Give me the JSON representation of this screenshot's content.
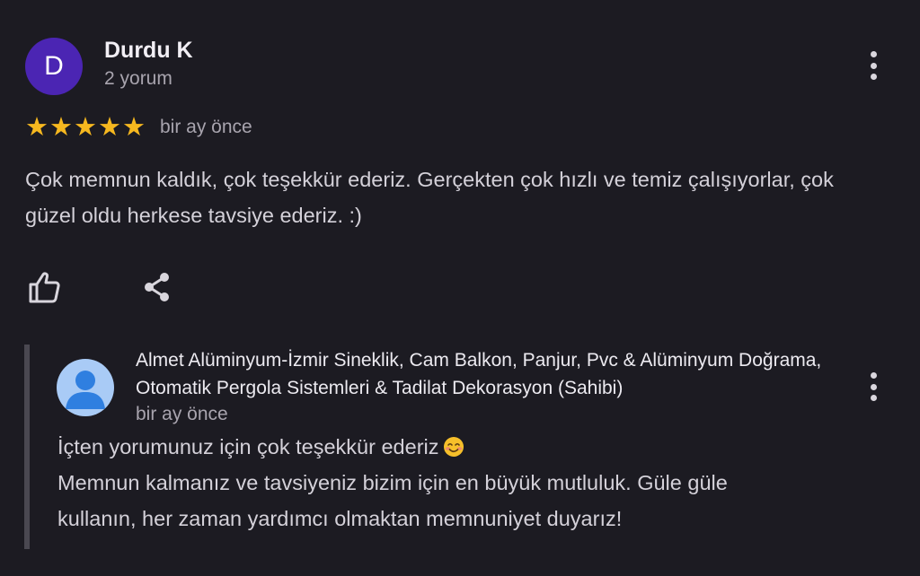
{
  "review": {
    "avatar_letter": "D",
    "author": "Durdu K",
    "review_count": "2 yorum",
    "rating": 5,
    "time": "bir ay önce",
    "text": "Çok memnun kaldık, çok teşekkür ederiz. Gerçekten çok hızlı ve temiz çalışıyorlar, çok güzel oldu herkese tavsiye ederiz. :)"
  },
  "icons": {
    "more": "more-vertical-icon",
    "like": "thumbs-up-icon",
    "share": "share-icon",
    "owner_avatar": "person-icon",
    "emoji": "smiling-face-emoji"
  },
  "owner_reply": {
    "name": "Almet Alüminyum-İzmir Sineklik, Cam Balkon, Panjur, Pvc & Alüminyum Doğrama, Otomatik Pergola Sistemleri & Tadilat Dekorasyon (Sahibi)",
    "time": "bir ay önce",
    "line1": "İçten yorumunuz için çok teşekkür ederiz",
    "line2": "Memnun kalmanız ve tavsiyeniz bizim için en büyük mutluluk. Güle güle",
    "line3": "kullanın, her zaman yardımcı olmaktan memnuniyet duyarız!"
  },
  "colors": {
    "background": "#1c1b22",
    "avatar": "#4b25b3",
    "star": "#f6b81f",
    "owner_avatar": "#a9cbf6"
  }
}
